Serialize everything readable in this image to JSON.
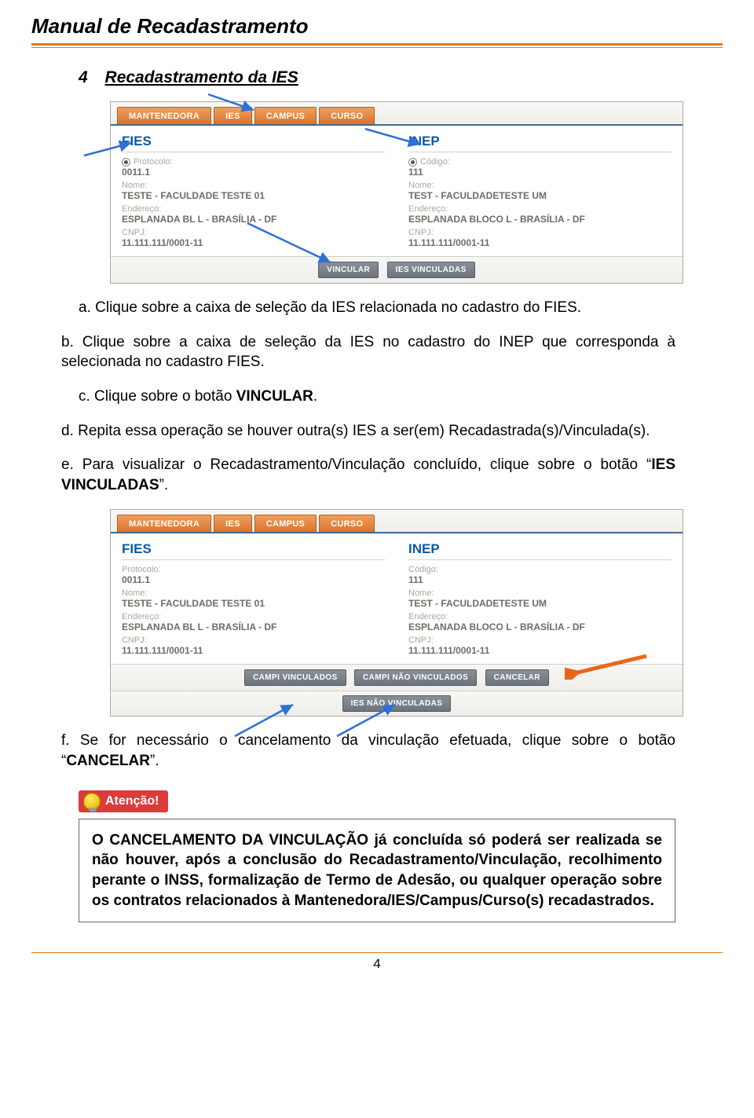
{
  "page_title": "Manual de Recadastramento",
  "section": {
    "number": "4",
    "title": "Recadastramento da IES"
  },
  "paragraphs": {
    "a": "a. Clique sobre a caixa de seleção da IES relacionada no cadastro do FIES.",
    "b": "b. Clique sobre a caixa de seleção da IES no cadastro do INEP que corresponda à selecionada no cadastro FIES.",
    "c_pre": "c. Clique sobre o botão ",
    "c_bold": "VINCULAR",
    "c_post": ".",
    "d": "d. Repita essa operação se houver outra(s) IES a ser(em) Recadastrada(s)/Vinculada(s).",
    "e_pre": "e. Para visualizar o Recadastramento/Vinculação concluído, clique sobre o botão “",
    "e_bold": "IES VINCULADAS",
    "e_post": "”.",
    "f_pre": "f. Se for necessário o cancelamento da vinculação efetuada, clique sobre o botão “",
    "f_bold": "CANCELAR",
    "f_post": "”."
  },
  "atencao_label": "Atenção!",
  "infobox": "O CANCELAMENTO DA VINCULAÇÃO já concluída só poderá ser realizada se não houver, após a conclusão do Recadastramento/Vinculação, recolhimento perante o INSS, formalização de Termo de Adesão, ou qualquer operação sobre os contratos relacionados à Mantenedora/IES/Campus/Curso(s) recadastrados.",
  "page_number": "4",
  "shot1": {
    "tabs": [
      "MANTENEDORA",
      "IES",
      "CAMPUS",
      "CURSO"
    ],
    "left_title": "FIES",
    "right_title": "INEP",
    "labels": {
      "protocolo": "Protocolo:",
      "codigo": "Código:",
      "nome": "Nome:",
      "endereco": "Endereço:",
      "cnpj": "CNPJ:"
    },
    "left": {
      "protocolo": "0011.1",
      "nome": "TESTE - FACULDADE TESTE 01",
      "endereco": "ESPLANADA BL L - BRASÍLIA - DF",
      "cnpj": "11.111.111/0001-11"
    },
    "right": {
      "codigo": "111",
      "nome": "TEST - FACULDADETESTE UM",
      "endereco": "ESPLANADA BLOCO L - BRASÍLIA - DF",
      "cnpj": "11.111.111/0001-11"
    },
    "buttons": [
      "VINCULAR",
      "IES VINCULADAS"
    ]
  },
  "shot2": {
    "tabs": [
      "MANTENEDORA",
      "IES",
      "CAMPUS",
      "CURSO"
    ],
    "left_title": "FIES",
    "right_title": "INEP",
    "labels": {
      "protocolo": "Protocolo:",
      "codigo": "Código:",
      "nome": "Nome:",
      "endereco": "Endereço:",
      "cnpj": "CNPJ:"
    },
    "left": {
      "protocolo": "0011.1",
      "nome": "TESTE - FACULDADE TESTE 01",
      "endereco": "ESPLANADA BL L - BRASÍLIA - DF",
      "cnpj": "11.111.111/0001-11"
    },
    "right": {
      "codigo": "111",
      "nome": "TEST - FACULDADETESTE UM",
      "endereco": "ESPLANADA BLOCO L - BRASÍLIA - DF",
      "cnpj": "11.111.111/0001-11"
    },
    "buttons_row1": [
      "CAMPI VINCULADOS",
      "CAMPI NÃO VINCULADOS",
      "CANCELAR"
    ],
    "buttons_row2": [
      "IES NÃO VINCULADAS"
    ]
  }
}
